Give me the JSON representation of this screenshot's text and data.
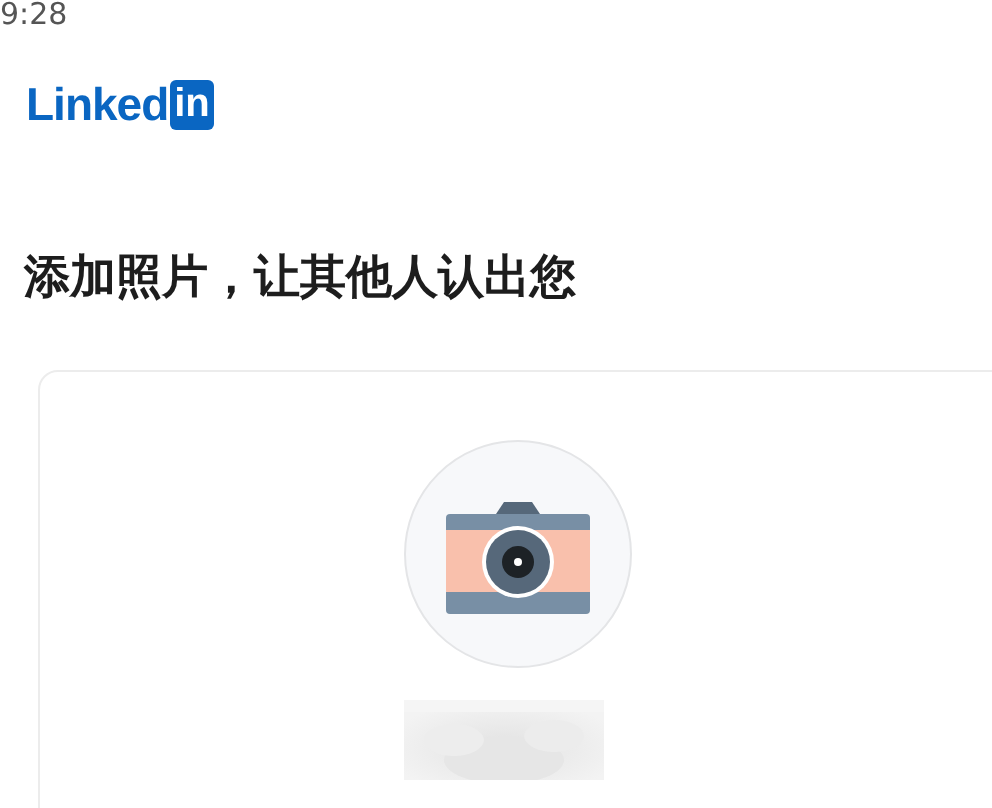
{
  "status_bar": {
    "time": "9:28"
  },
  "logo": {
    "text": "Linked",
    "badge": "in"
  },
  "heading": "添加照片，让其他人认出您"
}
